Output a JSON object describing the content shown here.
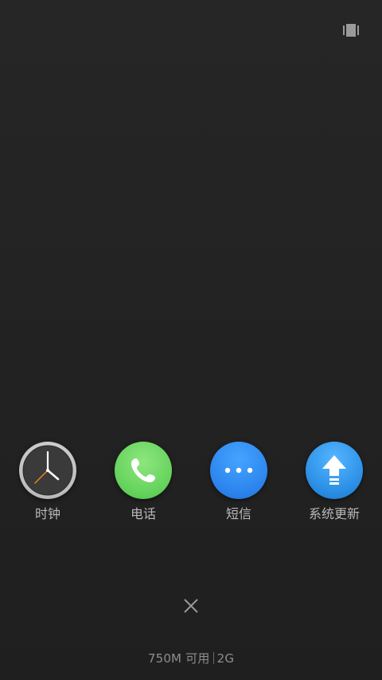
{
  "recent_apps": [
    {
      "label": "时钟",
      "icon": "clock-icon",
      "color": "#3a3a3a"
    },
    {
      "label": "电话",
      "icon": "phone-icon",
      "color": "#66d35d"
    },
    {
      "label": "短信",
      "icon": "message-icon",
      "color": "#2d86ee"
    },
    {
      "label": "系统更新",
      "icon": "update-icon",
      "color": "#2b90e6"
    }
  ],
  "memory": {
    "available": "750M 可用",
    "total": "2G"
  },
  "controls": {
    "layout_toggle_icon": "layout-toggle-icon",
    "close_icon": "close-icon"
  }
}
